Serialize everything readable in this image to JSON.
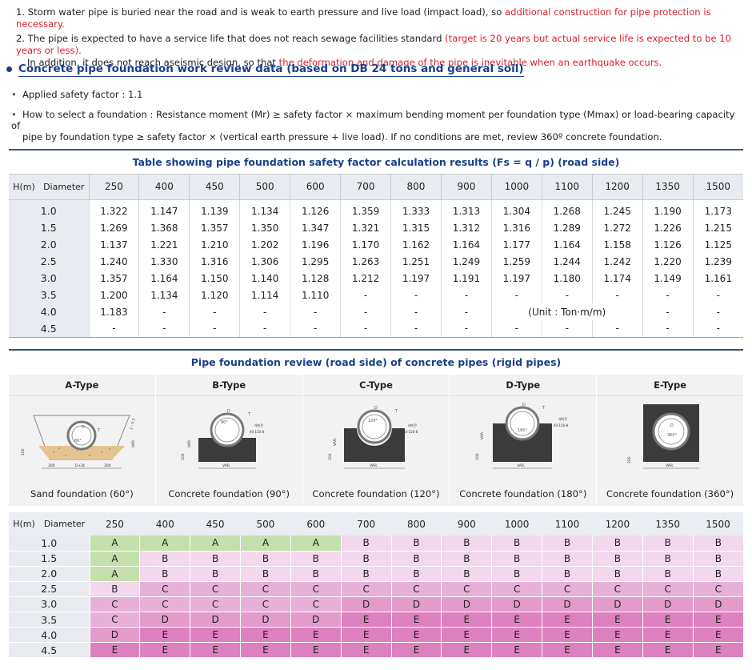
{
  "notes": {
    "n1_a": "1. Storm water pipe is buried near the road and is weak to earth pressure and live load (impact load), so ",
    "n1_b": "additional construction for pipe protection is necessary.",
    "n2_a": "2. The pipe is expected to have a service life that does not reach sewage facilities standard ",
    "n2_b": "(target is 20 years but actual service life is expected to be 10 years or less).",
    "n2_c": "In addition, it does not reach aseismic design, so that ",
    "n2_d": "the deformation and damage of the pipe is inevitable when an earthquake occurs."
  },
  "section_title": "Concrete pipe foundation work review data (based on DB 24 tons and general soil)",
  "bullets": {
    "b1": "Applied safety factor : 1.1",
    "b2_l1": "How to select a foundation : Resistance moment (Mr) ≥ safety factor × maximum bending moment per foundation type (Mmax) or load-bearing capacity of",
    "b2_l2": "pipe by foundation type ≥ safety factor × (vertical earth pressure + live load). If no conditions are met, review 360º concrete foundation."
  },
  "table1": {
    "title": "Table showing pipe foundation safety factor calculation results (Fs = q / p) (road side)",
    "h_label": "H(m)",
    "diameter_label": "Diameter",
    "diameters": [
      "250",
      "400",
      "450",
      "500",
      "600",
      "700",
      "800",
      "900",
      "1000",
      "1100",
      "1200",
      "1350",
      "1500"
    ],
    "unit_note": "(Unit : Ton·m/m)",
    "rows": [
      {
        "h": "1.0",
        "v": [
          "1.322",
          "1.147",
          "1.139",
          "1.134",
          "1.126",
          "1.359",
          "1.333",
          "1.313",
          "1.304",
          "1.268",
          "1.245",
          "1.190",
          "1.173"
        ]
      },
      {
        "h": "1.5",
        "v": [
          "1.269",
          "1.368",
          "1.357",
          "1.350",
          "1.347",
          "1.321",
          "1.315",
          "1.312",
          "1.316",
          "1.289",
          "1.272",
          "1.226",
          "1.215"
        ]
      },
      {
        "h": "2.0",
        "v": [
          "1.137",
          "1.221",
          "1.210",
          "1.202",
          "1.196",
          "1.170",
          "1.162",
          "1.164",
          "1.177",
          "1.164",
          "1.158",
          "1.126",
          "1.125"
        ]
      },
      {
        "h": "2.5",
        "v": [
          "1.240",
          "1.330",
          "1.316",
          "1.306",
          "1.295",
          "1.263",
          "1.251",
          "1.249",
          "1.259",
          "1.244",
          "1.242",
          "1.220",
          "1.239"
        ]
      },
      {
        "h": "3.0",
        "v": [
          "1.357",
          "1.164",
          "1.150",
          "1.140",
          "1.128",
          "1.212",
          "1.197",
          "1.191",
          "1.197",
          "1.180",
          "1.174",
          "1.149",
          "1.161"
        ]
      },
      {
        "h": "3.5",
        "v": [
          "1.200",
          "1.134",
          "1.120",
          "1.114",
          "1.110",
          "-",
          "-",
          "-",
          "-",
          "-",
          "-",
          "-",
          "-"
        ]
      },
      {
        "h": "4.0",
        "v": [
          "1.183",
          "-",
          "-",
          "-",
          "-",
          "-",
          "-",
          "-",
          "",
          "",
          "",
          "-",
          "-"
        ]
      },
      {
        "h": "4.5",
        "v": [
          "-",
          "-",
          "-",
          "-",
          "-",
          "-",
          "-",
          "-",
          "-",
          "-",
          "-",
          "-",
          "-"
        ]
      }
    ]
  },
  "panel": {
    "title": "Pipe foundation review (road side) of concrete pipes (rigid pipes)",
    "types": [
      {
        "name": "A-Type",
        "caption": "Sand foundation (60°)",
        "angle": "60°"
      },
      {
        "name": "B-Type",
        "caption": "Concrete foundation (90°)",
        "angle": "90°"
      },
      {
        "name": "C-Type",
        "caption": "Concrete foundation (120°)",
        "angle": "120°"
      },
      {
        "name": "D-Type",
        "caption": "Concrete foundation (180°)",
        "angle": "180°"
      },
      {
        "name": "E-Type",
        "caption": "Concrete foundation (360°)",
        "angle": "360°"
      }
    ],
    "drawing_labels": {
      "var": "VAR.",
      "d": "D",
      "t": "T",
      "slope": "1 : 0.3",
      "dim_300": "300",
      "dim_d2t": "D+2t",
      "dim_200": "200",
      "rebar": "40-150-8",
      "rebar_ko": "레미콘"
    }
  },
  "table2": {
    "h_label": "H(m)",
    "diameter_label": "Diameter",
    "diameters": [
      "250",
      "400",
      "450",
      "500",
      "600",
      "700",
      "800",
      "900",
      "1000",
      "1100",
      "1200",
      "1350",
      "1500"
    ],
    "rows": [
      {
        "h": "1.0",
        "v": [
          "A",
          "A",
          "A",
          "A",
          "A",
          "B",
          "B",
          "B",
          "B",
          "B",
          "B",
          "B",
          "B"
        ]
      },
      {
        "h": "1.5",
        "v": [
          "A",
          "B",
          "B",
          "B",
          "B",
          "B",
          "B",
          "B",
          "B",
          "B",
          "B",
          "B",
          "B"
        ]
      },
      {
        "h": "2.0",
        "v": [
          "A",
          "B",
          "B",
          "B",
          "B",
          "B",
          "B",
          "B",
          "B",
          "B",
          "B",
          "B",
          "B"
        ]
      },
      {
        "h": "2.5",
        "v": [
          "B",
          "C",
          "C",
          "C",
          "C",
          "C",
          "C",
          "C",
          "C",
          "C",
          "C",
          "C",
          "C"
        ]
      },
      {
        "h": "3.0",
        "v": [
          "C",
          "C",
          "C",
          "C",
          "C",
          "D",
          "D",
          "D",
          "D",
          "D",
          "D",
          "D",
          "D"
        ]
      },
      {
        "h": "3.5",
        "v": [
          "C",
          "D",
          "D",
          "D",
          "D",
          "E",
          "E",
          "E",
          "E",
          "E",
          "E",
          "E",
          "E"
        ]
      },
      {
        "h": "4.0",
        "v": [
          "D",
          "E",
          "E",
          "E",
          "E",
          "E",
          "E",
          "E",
          "E",
          "E",
          "E",
          "E",
          "E"
        ]
      },
      {
        "h": "4.5",
        "v": [
          "E",
          "E",
          "E",
          "E",
          "E",
          "E",
          "E",
          "E",
          "E",
          "E",
          "E",
          "E",
          "E"
        ]
      }
    ],
    "colors": {
      "A": "#c3e0ac",
      "B": "#f3d7ec",
      "C": "#e7b0d8",
      "D": "#e39bcc",
      "E": "#dd80bf"
    }
  }
}
